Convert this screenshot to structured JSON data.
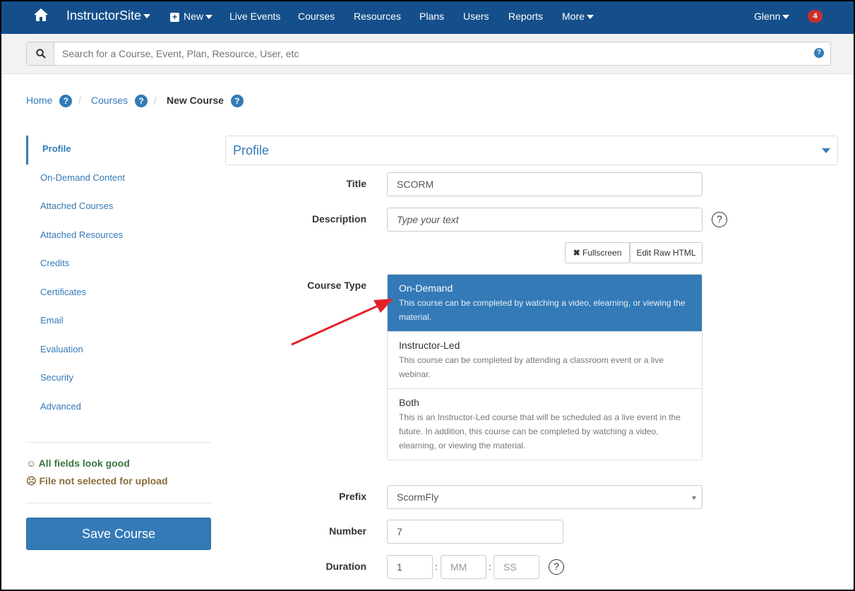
{
  "nav": {
    "site": "InstructorSite",
    "new": "New",
    "items": [
      "Live Events",
      "Courses",
      "Resources",
      "Plans",
      "Users",
      "Reports"
    ],
    "more": "More",
    "user": "Glenn",
    "notifications": "4",
    "color": "#154f8b"
  },
  "search": {
    "placeholder": "Search for a Course, Event, Plan, Resource, User, etc"
  },
  "breadcrumb": {
    "home": "Home",
    "courses": "Courses",
    "current": "New Course",
    "help": "?"
  },
  "sidebar": {
    "items": [
      "Profile",
      "On-Demand Content",
      "Attached Courses",
      "Attached Resources",
      "Credits",
      "Certificates",
      "Email",
      "Evaluation",
      "Security",
      "Advanced"
    ],
    "status_good": "All fields look good",
    "status_warn": "File not selected for upload",
    "save": "Save Course"
  },
  "panel": {
    "title": "Profile"
  },
  "form": {
    "title_label": "Title",
    "title_value": "SCORM",
    "desc_label": "Description",
    "desc_placeholder": "Type your text",
    "fullscreen": "Fullscreen",
    "raw_html": "Edit Raw HTML",
    "course_type_label": "Course Type",
    "course_types": [
      {
        "title": "On-Demand",
        "desc": "This course can be completed by watching a video, elearning, or viewing the material."
      },
      {
        "title": "Instructor-Led",
        "desc": "This course can be completed by attending a classroom event or a live webinar."
      },
      {
        "title": "Both",
        "desc": "This is an Instructor-Led course that will be scheduled as a live event in the future. In addition, this course can be completed by watching a video, elearning, or viewing the material."
      }
    ],
    "selected_course_type": "On-Demand",
    "prefix_label": "Prefix",
    "prefix_value": "ScormFly",
    "number_label": "Number",
    "number_value": "7",
    "duration_label": "Duration",
    "duration_hours": "1",
    "duration_mm_placeholder": "MM",
    "duration_ss_placeholder": "SS",
    "sep": ":",
    "help": "?"
  }
}
